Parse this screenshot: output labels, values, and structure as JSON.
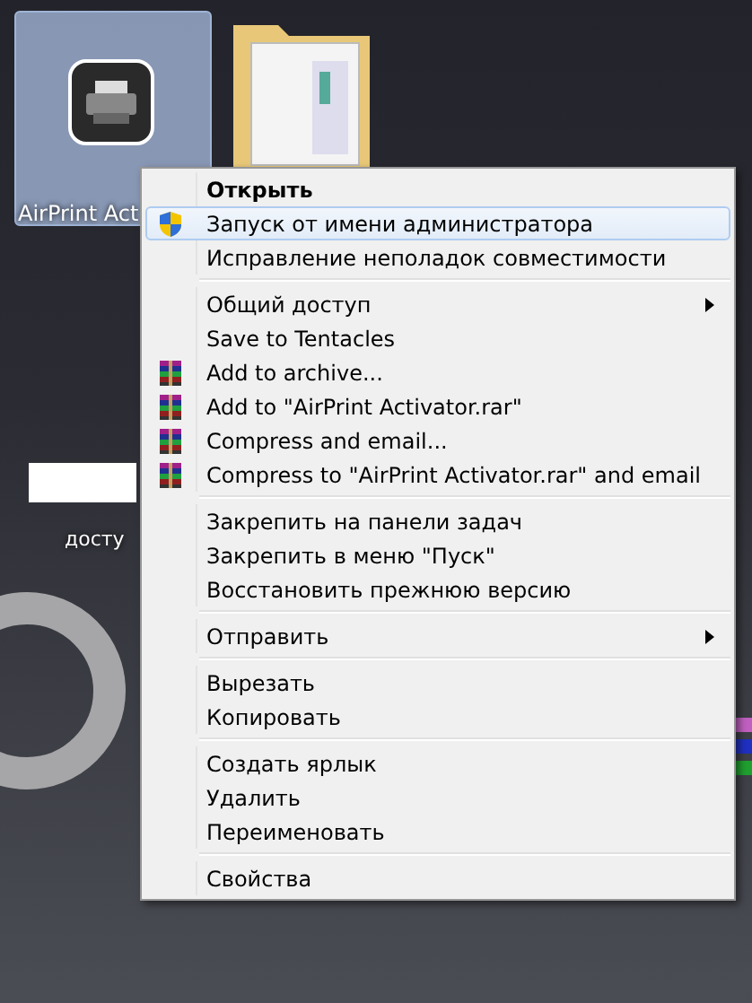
{
  "desktop": {
    "icons": [
      {
        "label": "AirPrint Act",
        "selected": true,
        "kind": "printer"
      },
      {
        "label": "досту",
        "kind": "document"
      }
    ]
  },
  "context_menu": {
    "groups": [
      {
        "items": [
          {
            "label": "Открыть",
            "default": true,
            "selected": false,
            "submenu": false
          },
          {
            "label": "Запуск от имени администратора",
            "default": false,
            "selected": true,
            "submenu": false,
            "kind": "shield"
          },
          {
            "label": "Исправление неполадок совместимости",
            "default": false,
            "selected": false,
            "submenu": false
          }
        ]
      },
      {
        "items": [
          {
            "label": "Общий доступ",
            "default": false,
            "selected": false,
            "submenu": true
          },
          {
            "label": "Save to Tentacles",
            "default": false,
            "selected": false,
            "submenu": false
          },
          {
            "label": "Add to archive...",
            "default": false,
            "selected": false,
            "submenu": false,
            "kind": "archive"
          },
          {
            "label": "Add to \"AirPrint Activator.rar\"",
            "default": false,
            "selected": false,
            "submenu": false,
            "kind": "archive"
          },
          {
            "label": "Compress and email...",
            "default": false,
            "selected": false,
            "submenu": false,
            "kind": "archive"
          },
          {
            "label": "Compress to \"AirPrint Activator.rar\" and email",
            "default": false,
            "selected": false,
            "submenu": false,
            "kind": "archive"
          }
        ]
      },
      {
        "items": [
          {
            "label": "Закрепить на панели задач",
            "default": false,
            "selected": false,
            "submenu": false
          },
          {
            "label": "Закрепить в меню \"Пуск\"",
            "default": false,
            "selected": false,
            "submenu": false
          },
          {
            "label": "Восстановить прежнюю версию",
            "default": false,
            "selected": false,
            "submenu": false
          }
        ]
      },
      {
        "items": [
          {
            "label": "Отправить",
            "default": false,
            "selected": false,
            "submenu": true
          }
        ]
      },
      {
        "items": [
          {
            "label": "Вырезать",
            "default": false,
            "selected": false,
            "submenu": false
          },
          {
            "label": "Копировать",
            "default": false,
            "selected": false,
            "submenu": false
          }
        ]
      },
      {
        "items": [
          {
            "label": "Создать ярлык",
            "default": false,
            "selected": false,
            "submenu": false
          },
          {
            "label": "Удалить",
            "default": false,
            "selected": false,
            "submenu": false
          },
          {
            "label": "Переименовать",
            "default": false,
            "selected": false,
            "submenu": false
          }
        ]
      },
      {
        "items": [
          {
            "label": "Свойства",
            "default": false,
            "selected": false,
            "submenu": false
          }
        ]
      }
    ]
  }
}
